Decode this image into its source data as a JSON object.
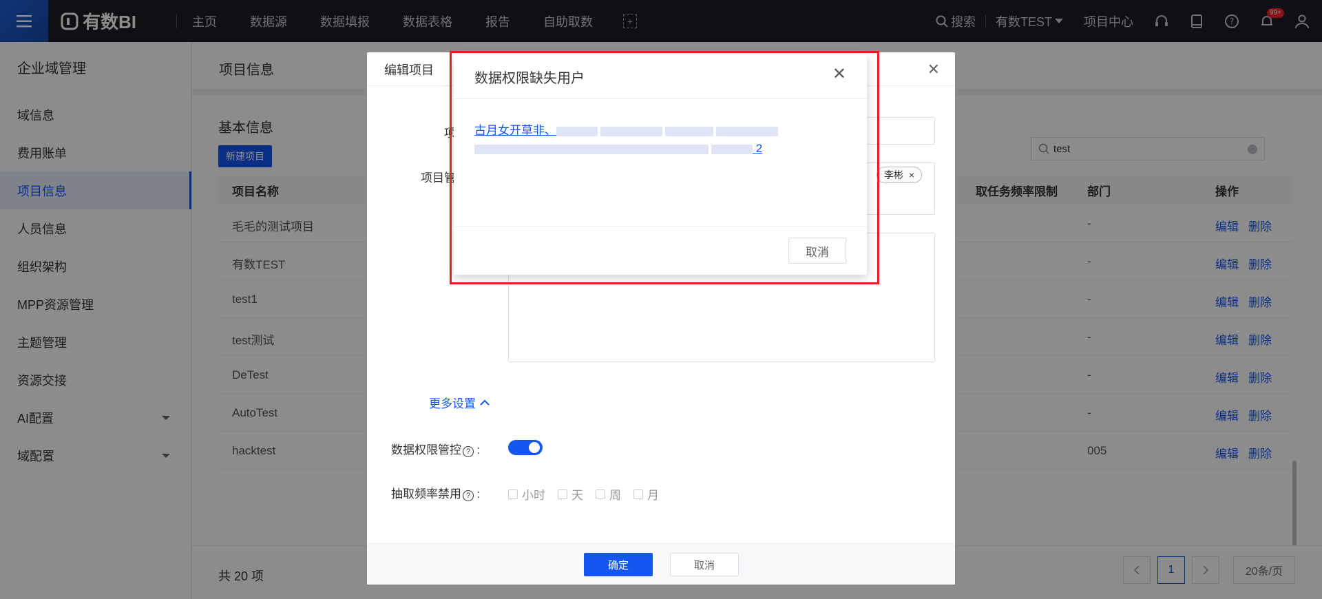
{
  "topbar": {
    "logo_text": "有数BI",
    "nav": [
      "主页",
      "数据源",
      "数据填报",
      "数据表格",
      "报告",
      "自助取数"
    ],
    "search_label": "搜索",
    "project_select": "有数TEST",
    "project_center": "项目中心",
    "notification_badge": "99+"
  },
  "sidebar": {
    "title": "企业域管理",
    "items": [
      "域信息",
      "费用账单",
      "项目信息",
      "人员信息",
      "组织架构",
      "MPP资源管理",
      "主题管理",
      "资源交接",
      "AI配置",
      "域配置"
    ]
  },
  "main": {
    "page_title": "项目信息",
    "section_title": "基本信息",
    "new_button": "新建项目",
    "search_value": "test",
    "columns": {
      "name": "项目名称",
      "freq": "取任务频率限制",
      "dept": "部门",
      "ops": "操作"
    },
    "rows": [
      {
        "name": "毛毛的测试项目",
        "dept": "-"
      },
      {
        "name": "有数TEST",
        "dept": "-"
      },
      {
        "name": "test1",
        "dept": "-"
      },
      {
        "name": "test测试",
        "dept": "-"
      },
      {
        "name": "DeTest",
        "dept": "-"
      },
      {
        "name": "AutoTest",
        "dept": "-"
      },
      {
        "name": "hacktest",
        "dept": "005"
      }
    ],
    "op_edit": "编辑",
    "op_delete": "删除",
    "total": "共 20 项",
    "current_page": "1",
    "page_size": "20条/页"
  },
  "edit_dialog": {
    "title": "编辑项目",
    "label_name": "项",
    "label_manager": "项目管",
    "tag_user": "李彬",
    "more_settings": "更多设置",
    "label_permission": "数据权限管控",
    "label_freq_ban": "抽取频率禁用",
    "checkbox_options": [
      "小时",
      "天",
      "周",
      "月"
    ],
    "ok": "确定",
    "cancel": "取消"
  },
  "popup": {
    "title": "数据权限缺失用户",
    "line1_prefix": "古月女开草非、",
    "line2_suffix": "2",
    "cancel": "取消"
  }
}
